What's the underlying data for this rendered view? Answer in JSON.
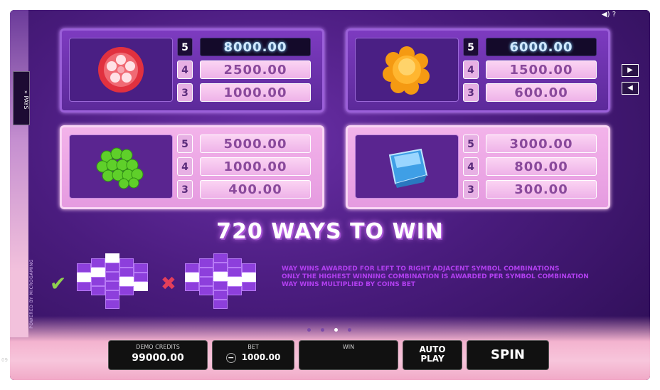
{
  "top_icons": "◀) ?",
  "side_tab": "» PAYS",
  "side_credit": "POWERED BY MICROGAMING",
  "paytable": [
    {
      "symbol": "red-candy",
      "rows": [
        {
          "n": "5",
          "v": "8000.00"
        },
        {
          "n": "4",
          "v": "2500.00"
        },
        {
          "n": "3",
          "v": "1000.00"
        }
      ]
    },
    {
      "symbol": "orange-jelly",
      "rows": [
        {
          "n": "5",
          "v": "6000.00"
        },
        {
          "n": "4",
          "v": "1500.00"
        },
        {
          "n": "3",
          "v": "600.00"
        }
      ]
    },
    {
      "symbol": "green-grapes",
      "rows": [
        {
          "n": "5",
          "v": "5000.00"
        },
        {
          "n": "4",
          "v": "1000.00"
        },
        {
          "n": "3",
          "v": "400.00"
        }
      ]
    },
    {
      "symbol": "blue-ice-cube",
      "rows": [
        {
          "n": "5",
          "v": "3000.00"
        },
        {
          "n": "4",
          "v": "800.00"
        },
        {
          "n": "3",
          "v": "300.00"
        }
      ]
    }
  ],
  "nav": {
    "next": "▶",
    "prev": "◀"
  },
  "ways_title": "720 WAYS TO WIN",
  "rules": [
    "WAY WINS AWARDED FOR LEFT TO RIGHT ADJACENT SYMBOL COMBINATIONS",
    "ONLY THE HIGHEST WINNING COMBINATION IS AWARDED PER SYMBOL COMBINATION",
    "WAY WINS MULTIPLIED BY COINS BET"
  ],
  "marks": {
    "ok": "✔",
    "bad": "✖"
  },
  "bottom": {
    "credits_label": "DEMO CREDITS",
    "credits_value": "99000.00",
    "bet_label": "BET",
    "bet_value": "1000.00",
    "bet_minus": "−",
    "win_label": "WIN",
    "win_value": "",
    "autoplay": "AUTO PLAY",
    "spin": "SPIN"
  },
  "version": "09"
}
